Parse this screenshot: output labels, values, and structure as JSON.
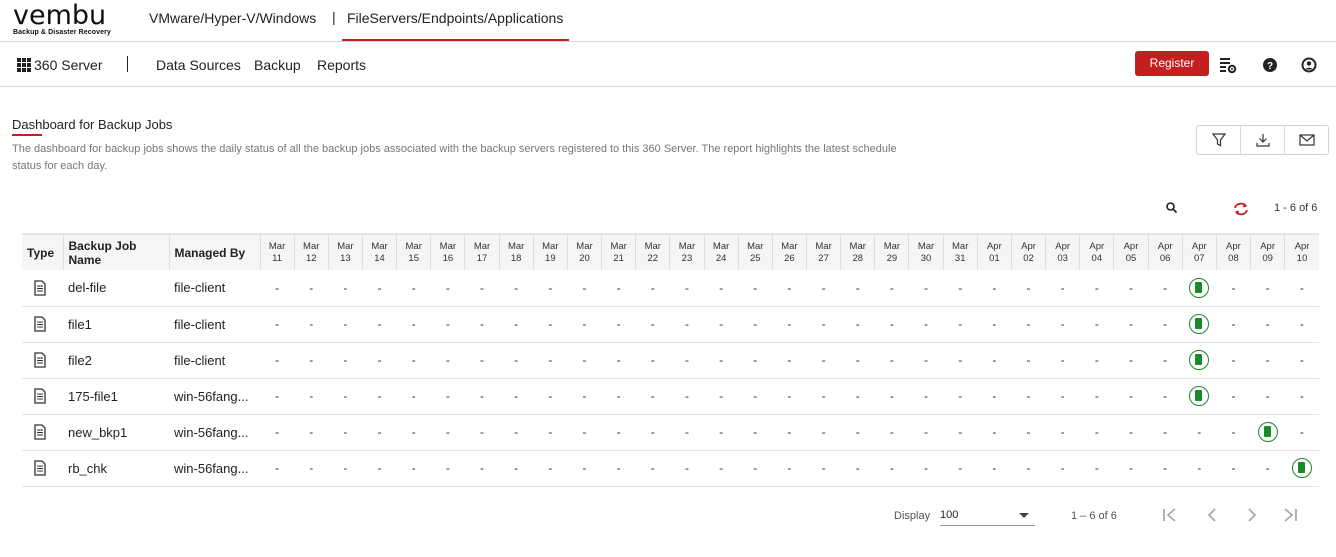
{
  "brand": {
    "name": "vembu",
    "tagline": "Backup & Disaster Recovery"
  },
  "top_tabs": [
    {
      "label": "VMware/Hyper-V/Windows"
    },
    {
      "label": "FileServers/Endpoints/Applications"
    }
  ],
  "top_separator": "|",
  "nav": {
    "server_label": "360 Server",
    "items": [
      {
        "label": "Data Sources"
      },
      {
        "label": "Backup"
      },
      {
        "label": "Reports"
      }
    ],
    "register_label": "Register",
    "icons": [
      "settings-icon",
      "help-icon",
      "user-icon"
    ]
  },
  "page": {
    "title": "Dashboard for Backup Jobs",
    "description": "The dashboard for backup jobs shows the daily status of all the backup jobs associated with the backup servers registered to this 360 Server. The report highlights the latest schedule status for each day.",
    "actions": [
      "filter-icon",
      "download-icon",
      "mail-icon"
    ],
    "count_top": "1 - 6 of 6"
  },
  "colors": {
    "accent": "#c41e1e",
    "success": "#1a8a2a"
  },
  "table": {
    "headers": {
      "type": "Type",
      "job": "Backup Job Name",
      "managed": "Managed By"
    },
    "dates": [
      {
        "m": "Mar",
        "d": "11"
      },
      {
        "m": "Mar",
        "d": "12"
      },
      {
        "m": "Mar",
        "d": "13"
      },
      {
        "m": "Mar",
        "d": "14"
      },
      {
        "m": "Mar",
        "d": "15"
      },
      {
        "m": "Mar",
        "d": "16"
      },
      {
        "m": "Mar",
        "d": "17"
      },
      {
        "m": "Mar",
        "d": "18"
      },
      {
        "m": "Mar",
        "d": "19"
      },
      {
        "m": "Mar",
        "d": "20"
      },
      {
        "m": "Mar",
        "d": "21"
      },
      {
        "m": "Mar",
        "d": "22"
      },
      {
        "m": "Mar",
        "d": "23"
      },
      {
        "m": "Mar",
        "d": "24"
      },
      {
        "m": "Mar",
        "d": "25"
      },
      {
        "m": "Mar",
        "d": "26"
      },
      {
        "m": "Mar",
        "d": "27"
      },
      {
        "m": "Mar",
        "d": "28"
      },
      {
        "m": "Mar",
        "d": "29"
      },
      {
        "m": "Mar",
        "d": "30"
      },
      {
        "m": "Mar",
        "d": "31"
      },
      {
        "m": "Apr",
        "d": "01"
      },
      {
        "m": "Apr",
        "d": "02"
      },
      {
        "m": "Apr",
        "d": "03"
      },
      {
        "m": "Apr",
        "d": "04"
      },
      {
        "m": "Apr",
        "d": "05"
      },
      {
        "m": "Apr",
        "d": "06"
      },
      {
        "m": "Apr",
        "d": "07"
      },
      {
        "m": "Apr",
        "d": "08"
      },
      {
        "m": "Apr",
        "d": "09"
      },
      {
        "m": "Apr",
        "d": "10"
      }
    ],
    "empty_marker": "-",
    "rows": [
      {
        "type_icon": "file-icon",
        "job": "del-file",
        "managed": "file-client",
        "success_on": [
          "Apr 07"
        ]
      },
      {
        "type_icon": "file-icon",
        "job": "file1",
        "managed": "file-client",
        "success_on": [
          "Apr 07"
        ]
      },
      {
        "type_icon": "file-icon",
        "job": "file2",
        "managed": "file-client",
        "success_on": [
          "Apr 07"
        ]
      },
      {
        "type_icon": "file-icon",
        "job": "175-file1",
        "managed": "win-56fang...",
        "success_on": [
          "Apr 07"
        ]
      },
      {
        "type_icon": "file-icon",
        "job": "new_bkp1",
        "managed": "win-56fang...",
        "success_on": [
          "Apr 09"
        ]
      },
      {
        "type_icon": "file-icon",
        "job": "rb_chk",
        "managed": "win-56fang...",
        "success_on": [
          "Apr 10"
        ]
      }
    ]
  },
  "pagination": {
    "display_label": "Display",
    "page_size": "100",
    "count": "1 – 6 of 6"
  }
}
